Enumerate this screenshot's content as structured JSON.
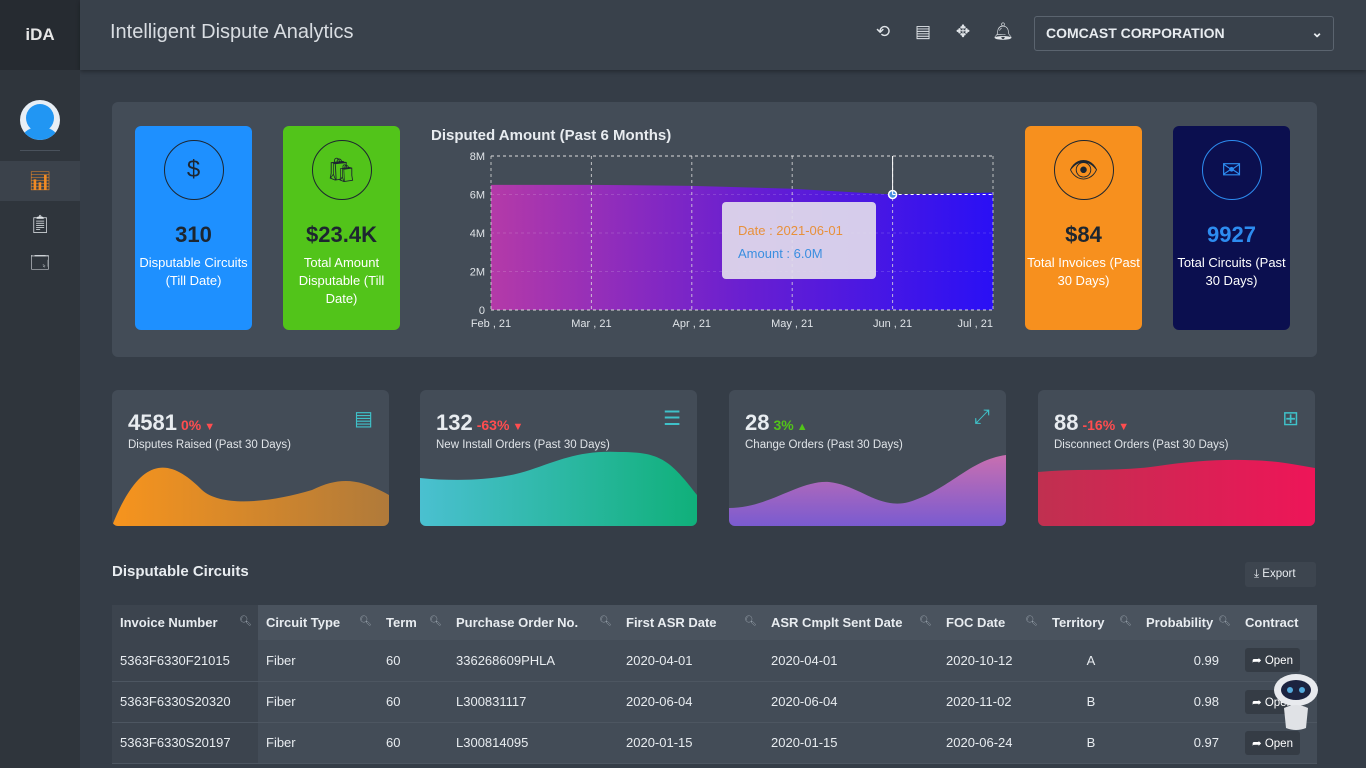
{
  "app": {
    "logo": "iDA",
    "title": "Intelligent Dispute Analytics",
    "company": "COMCAST CORPORATION"
  },
  "header_icons": [
    "history-icon",
    "list-icon",
    "move-icon",
    "bell-icon"
  ],
  "sidebar": {
    "items": [
      {
        "icon": "dashboard-chart-icon",
        "active": true
      },
      {
        "icon": "clipboard-icon"
      },
      {
        "icon": "report-icon"
      }
    ]
  },
  "stats": [
    {
      "value": "310",
      "label": "Disputable Circuits (Till Date)",
      "color": "#1e90ff",
      "icon": "money-hand-icon"
    },
    {
      "value": "$23.4K",
      "label": "Total Amount Disputable (Till Date)",
      "color": "#52c41a",
      "icon": "shopping-bag-icon"
    },
    {
      "value": "$84",
      "label": "Total Invoices (Past 30 Days)",
      "color": "#f7901e",
      "icon": "eye-mouse-icon"
    },
    {
      "value": "9927",
      "label": "Total Circuits (Past 30 Days)",
      "color": "#0b0f4f",
      "icon": "phone-mail-icon"
    }
  ],
  "chart_data": {
    "type": "area",
    "title": "Disputed Amount (Past 6 Months)",
    "categories": [
      "Feb , 21",
      "Mar , 21",
      "Apr , 21",
      "May , 21",
      "Jun , 21",
      "Jul , 21"
    ],
    "values": [
      6.5,
      6.5,
      6.45,
      6.3,
      6.0,
      6.1
    ],
    "unit": "M",
    "ylim": [
      0,
      8
    ],
    "yticks": [
      "0",
      "2M",
      "4M",
      "6M",
      "8M"
    ],
    "grid": true,
    "tooltip": {
      "date": "Date : 2021-06-01",
      "amount": "Amount : 6.0M"
    }
  },
  "kpis": [
    {
      "value": "4581",
      "change": "0%",
      "direction": "down",
      "label": "Disputes Raised (Past 30 Days)",
      "icon": "clipboard-icon"
    },
    {
      "value": "132",
      "change": "-63%",
      "direction": "down",
      "label": "New Install Orders (Past 30 Days)",
      "icon": "list-settings-icon"
    },
    {
      "value": "28",
      "change": "3%",
      "direction": "up",
      "label": "Change Orders (Past 30 Days)",
      "icon": "expand-icon"
    },
    {
      "value": "88",
      "change": "-16%",
      "direction": "down",
      "label": "Disconnect Orders (Past 30 Days)",
      "icon": "shapes-icon"
    }
  ],
  "table": {
    "title": "Disputable Circuits",
    "export": "Export",
    "columns": [
      "Invoice Number",
      "Circuit Type",
      "Term",
      "Purchase Order No.",
      "First ASR Date",
      "ASR Cmplt Sent Date",
      "FOC Date",
      "Territory",
      "Probability",
      "Contract"
    ],
    "rows": [
      [
        "5363F6330F21015",
        "Fiber",
        "60",
        "336268609PHLA",
        "2020-04-01",
        "2020-04-01",
        "2020-10-12",
        "A",
        "0.99",
        "Open"
      ],
      [
        "5363F6330S20320",
        "Fiber",
        "60",
        "L300831117",
        "2020-06-04",
        "2020-06-04",
        "2020-11-02",
        "B",
        "0.98",
        "Open"
      ],
      [
        "5363F6330S20197",
        "Fiber",
        "60",
        "L300814095",
        "2020-01-15",
        "2020-01-15",
        "2020-06-24",
        "B",
        "0.97",
        "Open"
      ]
    ]
  }
}
